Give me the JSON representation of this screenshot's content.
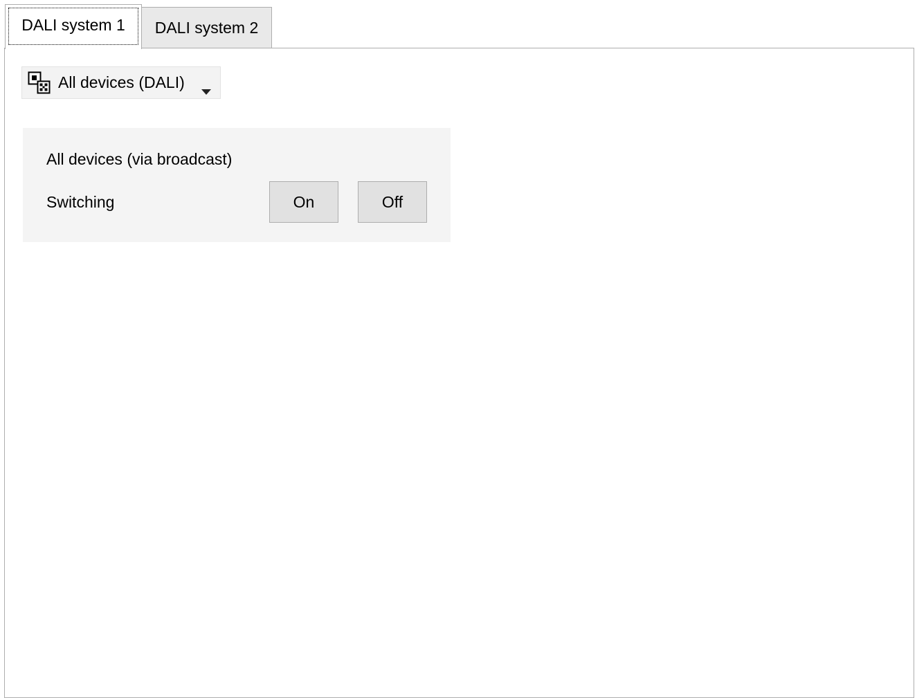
{
  "tabs": [
    {
      "label": "DALI system 1",
      "active": true
    },
    {
      "label": "DALI system 2",
      "active": false
    }
  ],
  "device_selector": {
    "icon": "device-group-icon",
    "selected": "All devices (DALI)"
  },
  "card": {
    "title": "All devices (via broadcast)",
    "switching_label": "Switching",
    "on_label": "On",
    "off_label": "Off"
  },
  "colors": {
    "card_background": "#f4f4f4",
    "button_background": "#e1e1e1",
    "border": "#adadad",
    "inactive_tab": "#e9e9e9"
  }
}
